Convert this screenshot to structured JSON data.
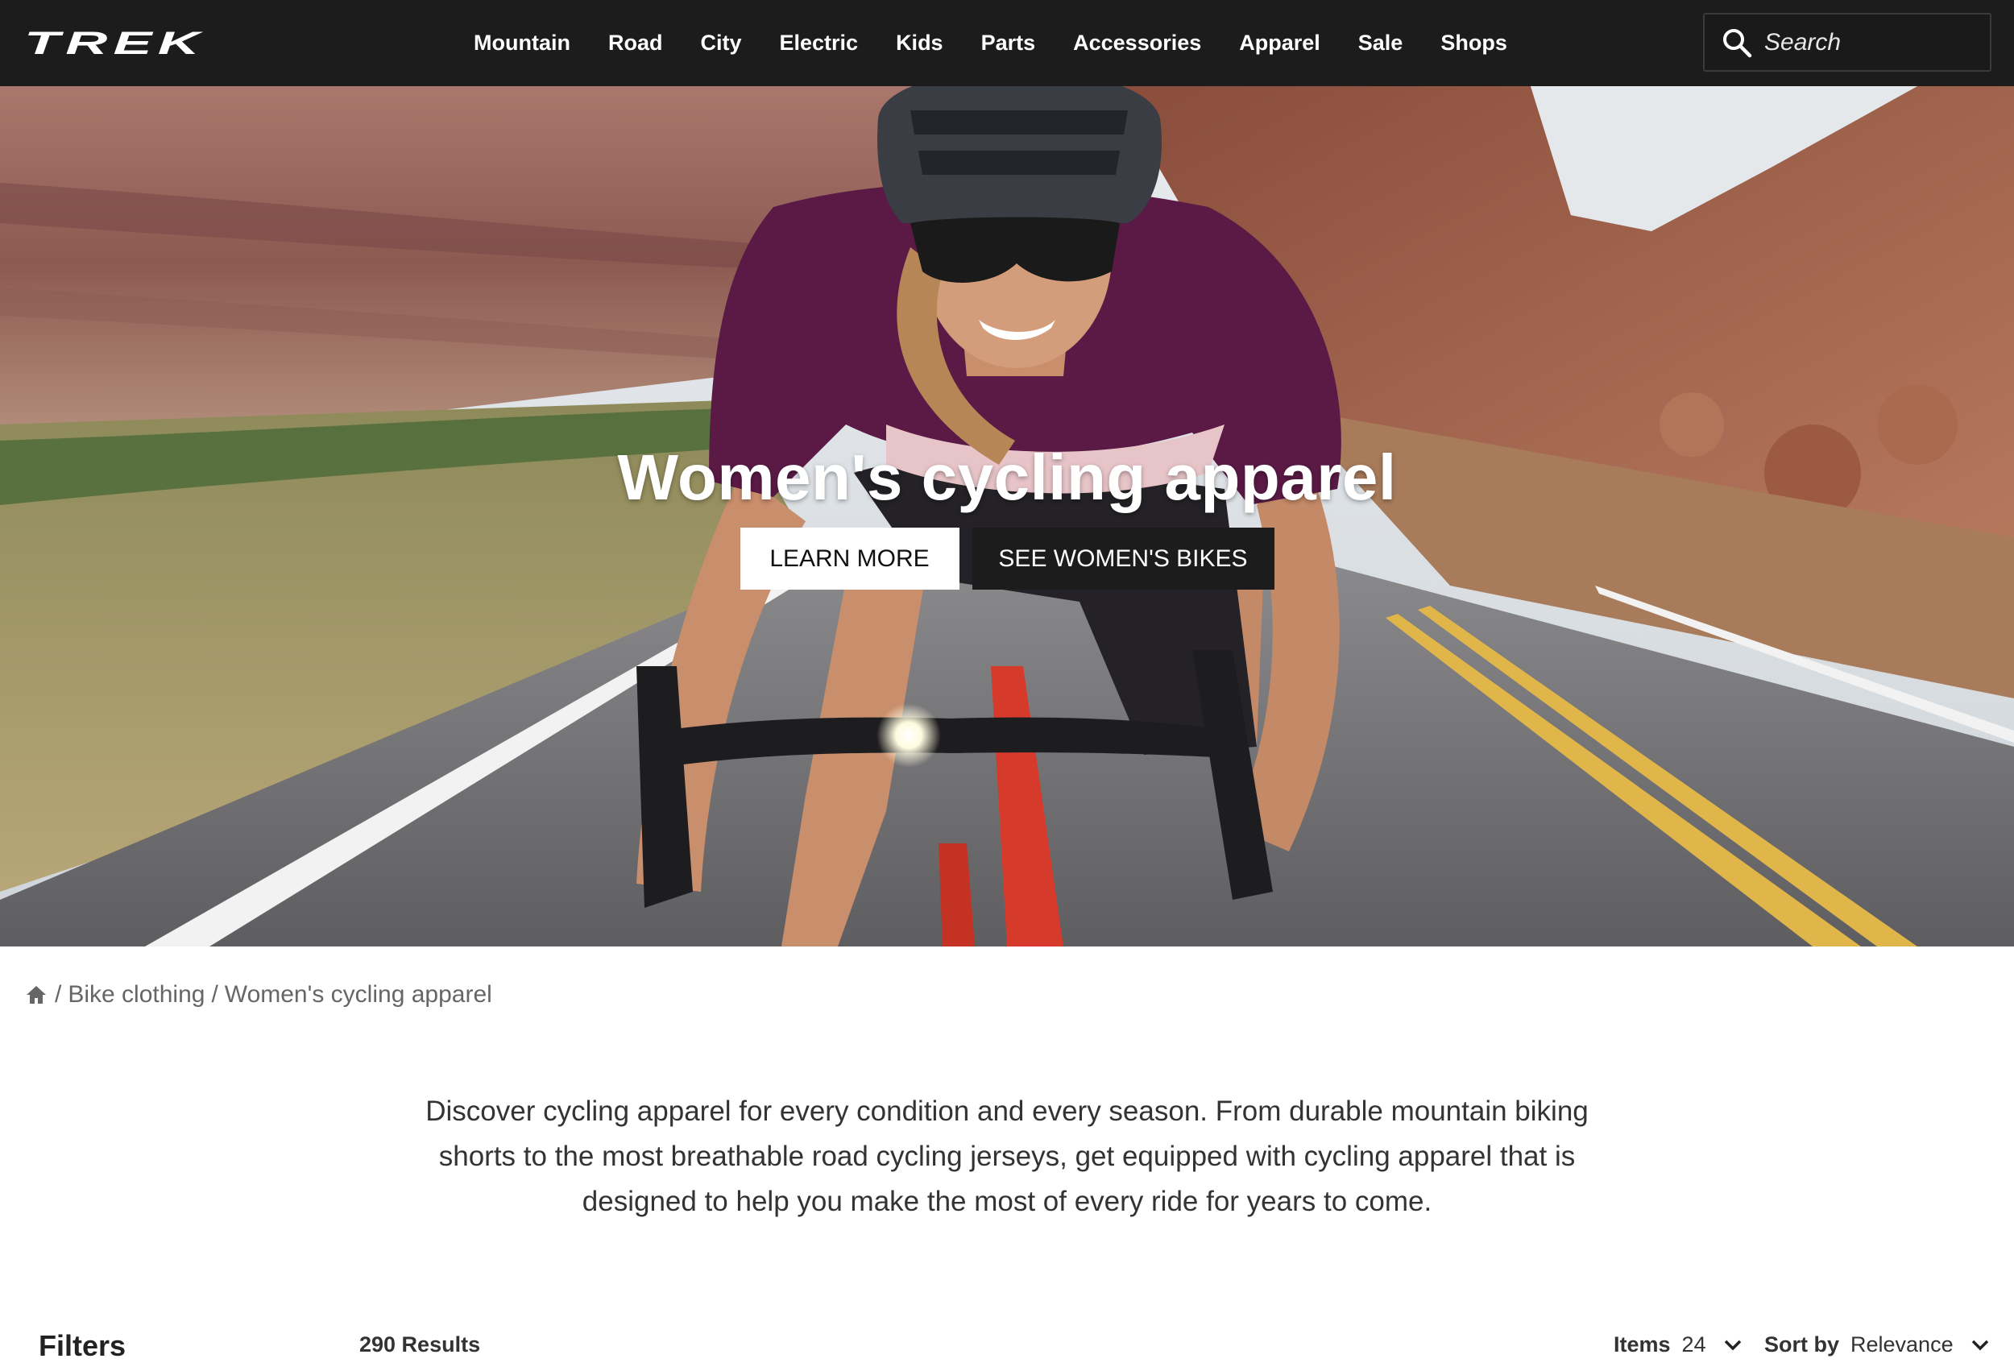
{
  "header": {
    "logo_text": "TREK",
    "nav": [
      "Mountain",
      "Road",
      "City",
      "Electric",
      "Kids",
      "Parts",
      "Accessories",
      "Apparel",
      "Sale",
      "Shops"
    ],
    "search_placeholder": "Search"
  },
  "hero": {
    "title": "Women's cycling apparel",
    "learn_more": "LEARN MORE",
    "see_bikes": "SEE WOMEN'S BIKES"
  },
  "breadcrumb": {
    "items": [
      "Bike clothing",
      "Women's cycling apparel"
    ]
  },
  "intro": {
    "text": "Discover cycling apparel for every condition and every season. From durable mountain biking shorts to the most breathable road cycling jerseys, get equipped with cycling apparel that is designed to help you make the most of every ride for years to come."
  },
  "toolbar": {
    "filters_label": "Filters",
    "results": "290 Results",
    "items_label": "Items",
    "items_value": "24",
    "sort_label": "Sort by",
    "sort_value": "Relevance"
  },
  "colors": {
    "header_bg": "#1c1c1c",
    "jersey": "#5a1a45",
    "frame": "#d63a2a"
  }
}
